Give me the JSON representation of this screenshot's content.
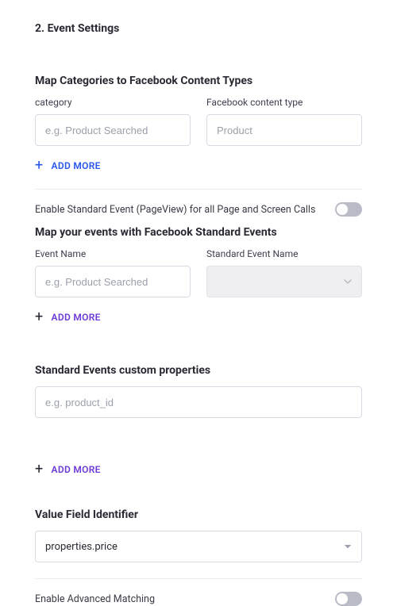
{
  "section_title": "2. Event Settings",
  "map_categories": {
    "title": "Map Categories to Facebook Content Types",
    "left_label": "category",
    "left_placeholder": "e.g. Product Searched",
    "right_label": "Facebook content type",
    "right_placeholder": "Product",
    "add_more": "ADD MORE"
  },
  "enable_pageview": {
    "label": "Enable Standard Event (PageView) for all Page and Screen Calls",
    "value": false
  },
  "map_events": {
    "title": "Map your events with Facebook Standard Events",
    "left_label": "Event Name",
    "left_placeholder": "e.g. Product Searched",
    "right_label": "Standard Event Name",
    "add_more": "ADD MORE"
  },
  "custom_props": {
    "title": "Standard Events custom properties",
    "placeholder": "e.g. product_id",
    "add_more": "ADD MORE"
  },
  "value_field": {
    "title": "Value Field Identifier",
    "selected": "properties.price"
  },
  "adv_matching": {
    "label": "Enable Advanced Matching",
    "value": false
  }
}
